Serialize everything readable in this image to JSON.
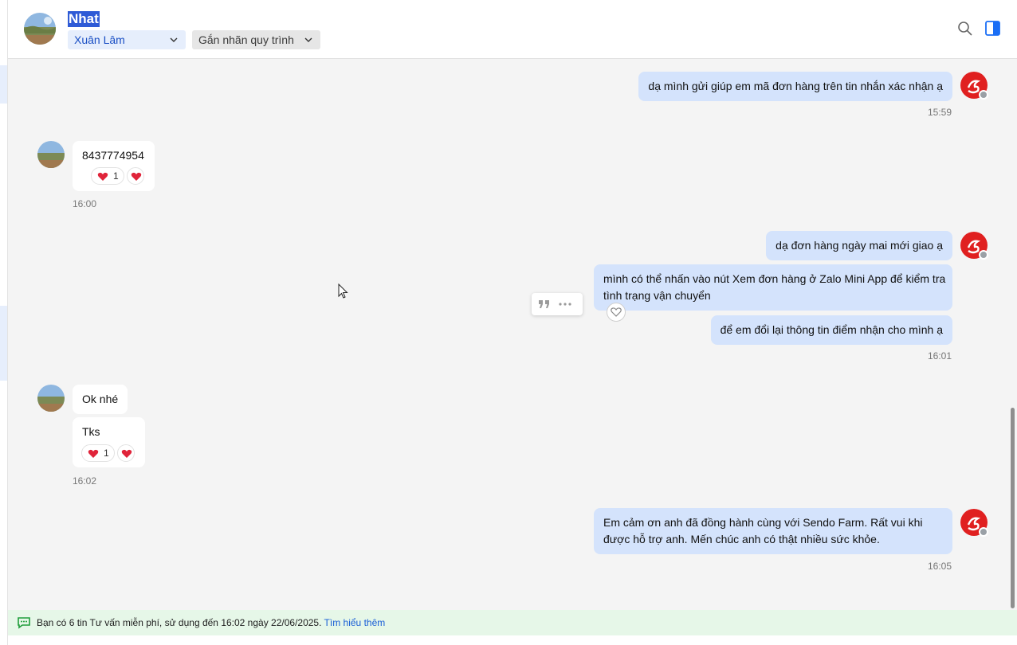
{
  "header": {
    "contact_name": "Nhat",
    "assignee": "Xuân Lâm",
    "tag_label": "Gắn nhãn quy trình",
    "icons": [
      "search-icon",
      "side-panel-icon",
      "chevron-down-icon"
    ]
  },
  "messages": {
    "m1": {
      "text": "dạ mình gửi giúp em mã đơn hàng trên tin nhắn xác nhận ạ",
      "time": "15:59"
    },
    "m2": {
      "text": "8437774954",
      "reaction_count": "1",
      "time": "16:00"
    },
    "m3": {
      "text": "dạ đơn hàng ngày mai mới giao ạ"
    },
    "m4": {
      "line1": "mình có thể nhấn vào nút Xem đơn hàng ở Zalo Mini App để kiểm tra",
      "line2": "tình trạng vận chuyển"
    },
    "m5": {
      "text": "để em đổi lại thông tin điểm nhận cho mình ạ",
      "time": "16:01"
    },
    "m6": {
      "text": "Ok nhé"
    },
    "m7": {
      "text": "Tks",
      "reaction_count": "1",
      "time": "16:02"
    },
    "m8": {
      "line1": "Em cảm ơn anh đã đồng hành cùng với Sendo Farm. Rất vui khi",
      "line2": "được hỗ trợ anh. Mến chúc anh có thật nhiều sức khỏe.",
      "time": "16:05"
    }
  },
  "notice": {
    "text": "Bạn có 6 tin Tư vấn miễn phí, sử dụng đến 16:02 ngày 22/06/2025. ",
    "link": "Tìm hiểu thêm"
  },
  "colors": {
    "accent": "#2f5bd6",
    "outgoing_bubble": "#d4e3fc",
    "incoming_bubble": "#ffffff",
    "notice_bg": "#e6f7e8",
    "shop_avatar": "#e02020"
  }
}
